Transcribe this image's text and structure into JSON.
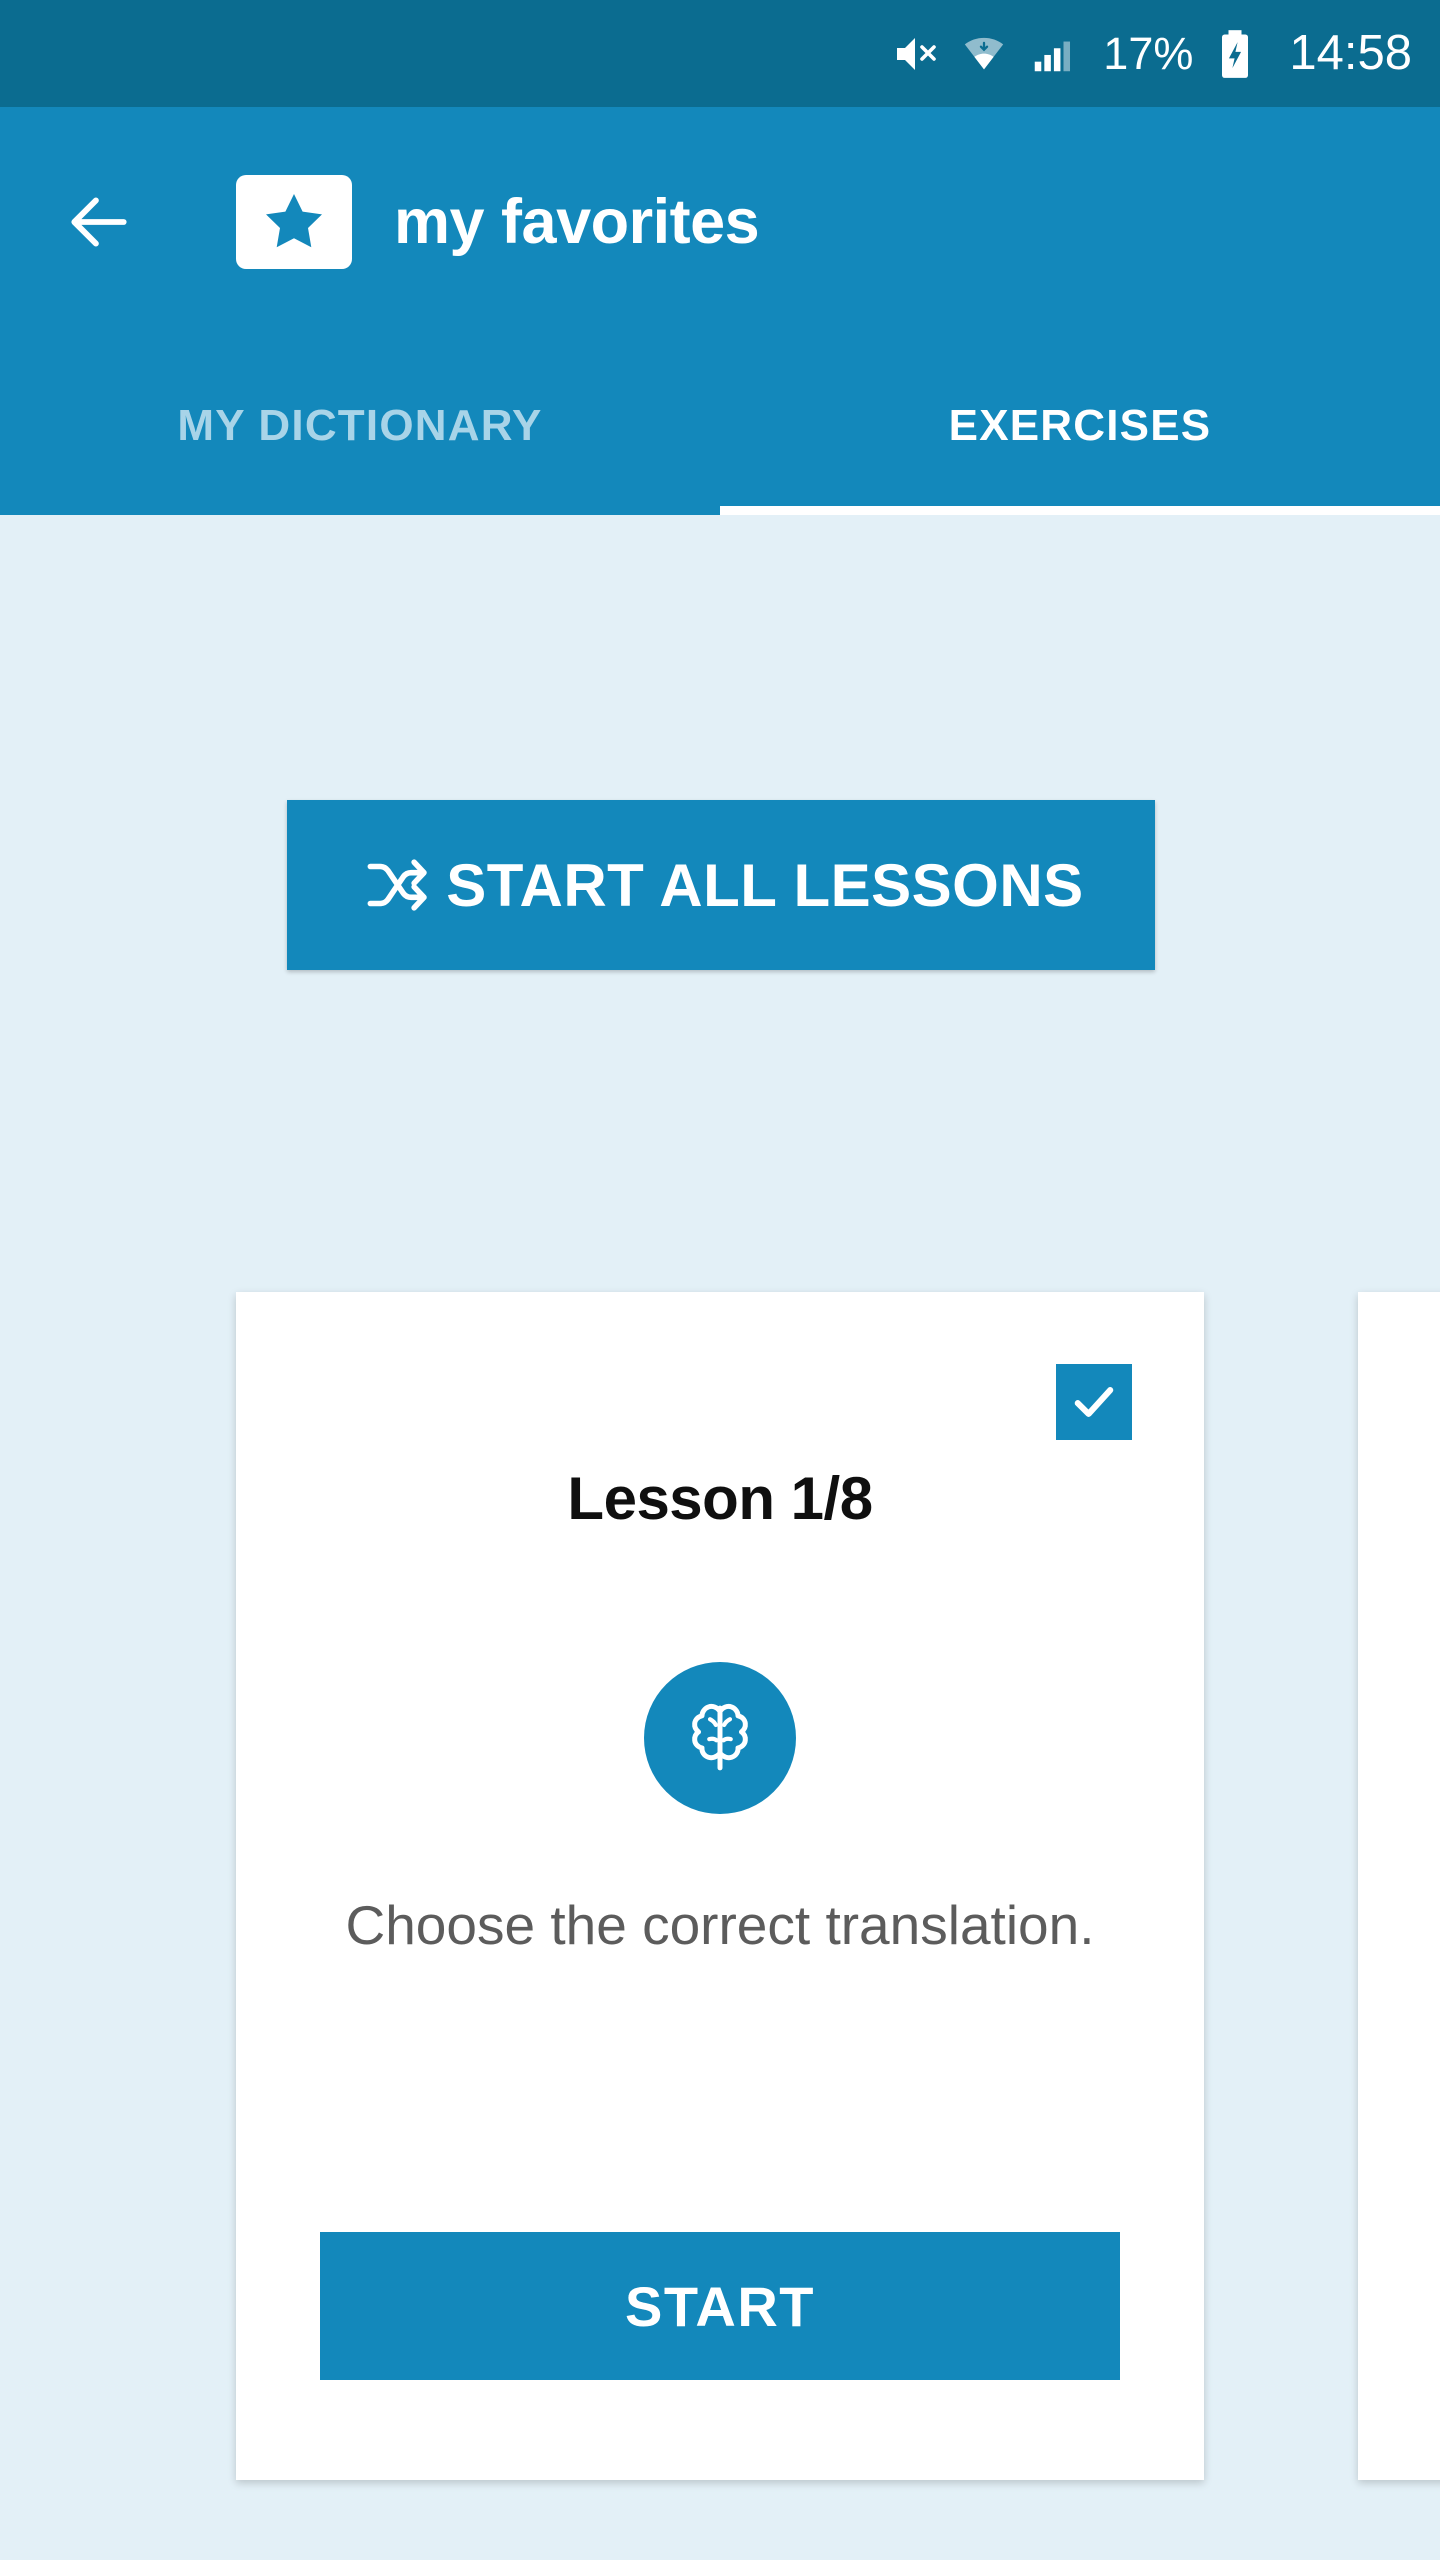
{
  "status_bar": {
    "background": "#0b6c90",
    "mute_icon": "mute-icon",
    "wifi_icon": "wifi-icon",
    "signal_icon": "cellular-signal-icon",
    "battery_percent": "17%",
    "battery_icon": "battery-charging-icon",
    "clock": "14:58"
  },
  "app_bar": {
    "background": "#1388bb",
    "back_icon": "back-arrow-icon",
    "folder_icon": "favorites-folder-star-icon",
    "title": "my favorites"
  },
  "tabs": {
    "items": [
      {
        "label": "MY DICTIONARY",
        "active": false
      },
      {
        "label": "EXERCISES",
        "active": true
      }
    ]
  },
  "main": {
    "background": "#e3f0f7",
    "start_all": {
      "label": "START ALL LESSONS",
      "icon": "shuffle-icon",
      "color": "#1388bb"
    },
    "cards": [
      {
        "title": "Lesson 1/8",
        "badge_icon": "brain-icon",
        "description": "Choose the correct translation.",
        "start_label": "START",
        "checked": true,
        "check_icon": "checkmark-icon",
        "accent": "#1388bb"
      },
      {
        "title": "",
        "badge_icon": "brain-icon",
        "description": "",
        "start_label": "",
        "checked": false,
        "check_icon": "checkmark-icon",
        "accent": "#1388bb"
      }
    ]
  }
}
